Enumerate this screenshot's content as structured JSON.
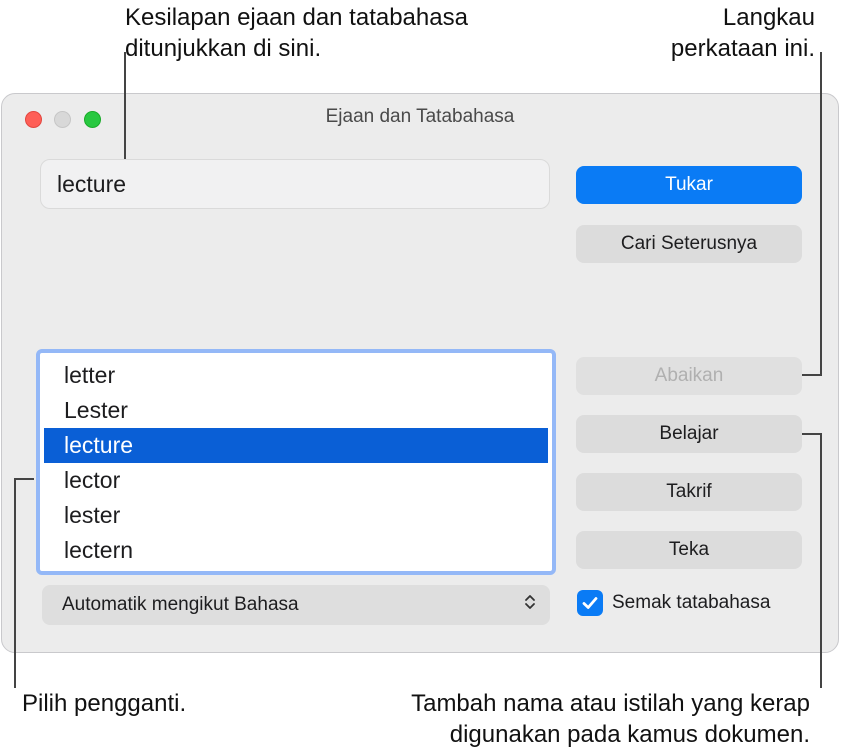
{
  "callouts": {
    "top_left": "Kesilapan ejaan dan tatabahasa\nditunjukkan di sini.",
    "top_right": "Langkau\nperkataan ini.",
    "bottom_left": "Pilih pengganti.",
    "bottom_right": "Tambah nama atau istilah yang kerap\ndigunakan pada kamus dokumen."
  },
  "window": {
    "title": "Ejaan dan Tatabahasa"
  },
  "word_field": {
    "value": "lecture"
  },
  "buttons": {
    "tukar": "Tukar",
    "cari": "Cari Seterusnya",
    "abaikan": "Abaikan",
    "belajar": "Belajar",
    "takrif": "Takrif",
    "teka": "Teka"
  },
  "suggestions": [
    "letter",
    "Lester",
    "lecture",
    "lector",
    "lester",
    "lectern"
  ],
  "selected_index": 2,
  "language_popup": {
    "value": "Automatik mengikut Bahasa"
  },
  "grammar_check": {
    "label": "Semak tatabahasa",
    "checked": true
  },
  "colors": {
    "accent": "#0a7bf5",
    "selection": "#0a5fd6",
    "list_focus_ring": "#94b8f7"
  }
}
